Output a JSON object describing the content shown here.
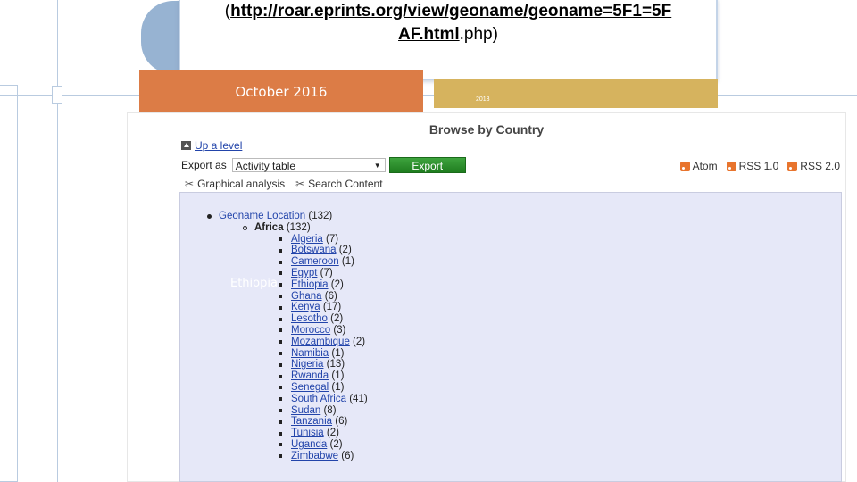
{
  "slide": {
    "url_prefix": "(",
    "url_link": "http://roar.eprints.org/view/geoname/geoname=5F1=5FAF.html",
    "url_line1": "http://roar.eprints.org/view/geoname/geoname=5F1=5F",
    "url_line2": "AF.html",
    "url_suffix": ".php)",
    "date": "October 2016",
    "year_small": "2013",
    "overlay_label": "Ethiopia"
  },
  "page": {
    "heading": "Browse by Country",
    "up_level": "Up a level",
    "export_label": "Export as",
    "export_select_value": "Activity table",
    "export_button": "Export",
    "feeds": [
      "Atom",
      "RSS 1.0",
      "RSS 2.0"
    ],
    "tools": [
      "Graphical analysis",
      "Search Content"
    ]
  },
  "tree": {
    "root_label": "Geoname Location",
    "root_count": "(132)",
    "region_label": "Africa",
    "region_count": "(132)",
    "countries": [
      {
        "name": "Algeria",
        "count": "(7)"
      },
      {
        "name": "Botswana",
        "count": "(2)"
      },
      {
        "name": "Cameroon",
        "count": "(1)"
      },
      {
        "name": "Egypt",
        "count": "(7)"
      },
      {
        "name": "Ethiopia",
        "count": "(2)"
      },
      {
        "name": "Ghana",
        "count": "(6)"
      },
      {
        "name": "Kenya",
        "count": "(17)"
      },
      {
        "name": "Lesotho",
        "count": "(2)"
      },
      {
        "name": "Morocco",
        "count": "(3)"
      },
      {
        "name": "Mozambique",
        "count": "(2)"
      },
      {
        "name": "Namibia",
        "count": "(1)"
      },
      {
        "name": "Nigeria",
        "count": "(13)"
      },
      {
        "name": "Rwanda",
        "count": "(1)"
      },
      {
        "name": "Senegal",
        "count": "(1)"
      },
      {
        "name": "South Africa",
        "count": "(41)"
      },
      {
        "name": "Sudan",
        "count": "(8)"
      },
      {
        "name": "Tanzania",
        "count": "(6)"
      },
      {
        "name": "Tunisia",
        "count": "(2)"
      },
      {
        "name": "Uganda",
        "count": "(2)"
      },
      {
        "name": "Zimbabwe",
        "count": "(6)"
      }
    ]
  }
}
